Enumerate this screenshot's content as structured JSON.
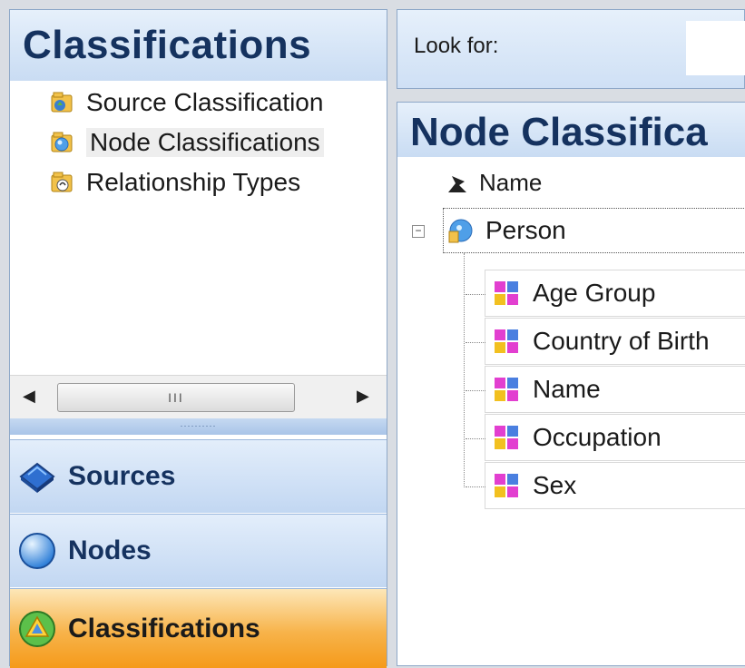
{
  "left": {
    "title": "Classifications",
    "tree": [
      {
        "label": "Source Classification",
        "icon": "source-classification-icon"
      },
      {
        "label": "Node Classifications",
        "icon": "node-classifications-icon",
        "selected": true
      },
      {
        "label": "Relationship Types",
        "icon": "relationship-types-icon"
      }
    ],
    "scroll_thumb": "III",
    "nav": [
      {
        "label": "Sources",
        "icon": "sources-icon"
      },
      {
        "label": "Nodes",
        "icon": "nodes-icon"
      },
      {
        "label": "Classifications",
        "icon": "classifications-icon",
        "active": true
      }
    ]
  },
  "search": {
    "label": "Look for:",
    "value": ""
  },
  "main": {
    "title": "Node Classifica",
    "column": "Name",
    "root": {
      "label": "Person",
      "expander": "−"
    },
    "children": [
      "Age Group",
      "Country of Birth",
      "Name",
      "Occupation",
      "Sex"
    ]
  },
  "colors": {
    "header_text": "#15325f",
    "active_nav": "#f7b34a",
    "pane_border": "#8ea8c8"
  }
}
